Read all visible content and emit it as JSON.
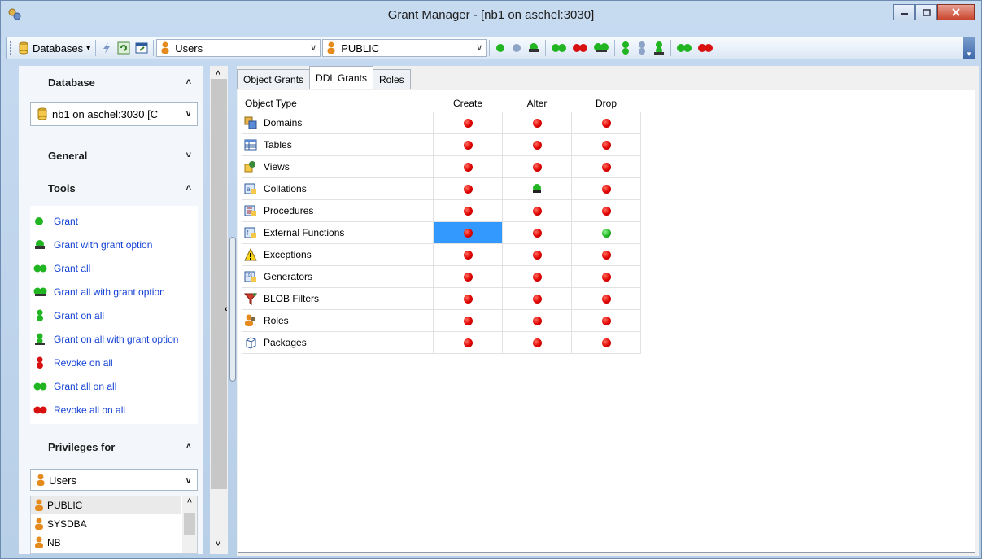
{
  "window": {
    "title": "Grant Manager - [nb1 on aschel:3030]"
  },
  "toolbar": {
    "databases_label": "Databases",
    "dropdown_arrow": "▾",
    "object_kind_value": "Users",
    "grantee_value": "PUBLIC"
  },
  "sidebar": {
    "database_header": "Database",
    "database_value": "nb1 on aschel:3030 [C",
    "general_header": "General",
    "tools_header": "Tools",
    "tools": [
      {
        "label": "Grant",
        "icon": "grant-icon"
      },
      {
        "label": "Grant with grant option",
        "icon": "grant-with-option-icon"
      },
      {
        "label": "Grant all",
        "icon": "grant-all-icon"
      },
      {
        "label": "Grant all with grant option",
        "icon": "grant-all-with-option-icon"
      },
      {
        "label": "Grant on all",
        "icon": "grant-on-all-icon"
      },
      {
        "label": "Grant on all with grant option",
        "icon": "grant-on-all-with-option-icon"
      },
      {
        "label": "Revoke on all",
        "icon": "revoke-on-all-icon"
      },
      {
        "label": "Grant all on all",
        "icon": "grant-all-on-all-icon"
      },
      {
        "label": "Revoke all on all",
        "icon": "revoke-all-on-all-icon"
      }
    ],
    "privileges_header": "Privileges for",
    "privileges_value": "Users",
    "users": [
      "PUBLIC",
      "SYSDBA",
      "NB"
    ],
    "chevron_up": "˄",
    "chevron_down": "˅"
  },
  "tabs": [
    "Object Grants",
    "DDL Grants",
    "Roles"
  ],
  "grid": {
    "headers": [
      "Object Type",
      "Create",
      "Alter",
      "Drop"
    ],
    "rows": [
      {
        "name": "Domains",
        "icon": "domain-icon",
        "create": "red",
        "alter": "red",
        "drop": "red"
      },
      {
        "name": "Tables",
        "icon": "table-icon",
        "create": "red",
        "alter": "red",
        "drop": "red"
      },
      {
        "name": "Views",
        "icon": "view-icon",
        "create": "red",
        "alter": "red",
        "drop": "red"
      },
      {
        "name": "Collations",
        "icon": "collation-icon",
        "create": "red",
        "alter": "grant-option",
        "drop": "red"
      },
      {
        "name": "Procedures",
        "icon": "procedure-icon",
        "create": "red",
        "alter": "red",
        "drop": "red"
      },
      {
        "name": "External Functions",
        "icon": "udf-icon",
        "create": "red",
        "alter": "red",
        "drop": "green"
      },
      {
        "name": "Exceptions",
        "icon": "warning-icon",
        "create": "red",
        "alter": "red",
        "drop": "red"
      },
      {
        "name": "Generators",
        "icon": "generator-icon",
        "create": "red",
        "alter": "red",
        "drop": "red"
      },
      {
        "name": "BLOB Filters",
        "icon": "filter-icon",
        "create": "red",
        "alter": "red",
        "drop": "red"
      },
      {
        "name": "Roles",
        "icon": "roles-icon",
        "create": "red",
        "alter": "red",
        "drop": "red"
      },
      {
        "name": "Packages",
        "icon": "package-icon",
        "create": "red",
        "alter": "red",
        "drop": "red"
      }
    ],
    "selected_cell": {
      "row": "External Functions",
      "column": "Create"
    }
  },
  "colors": {
    "link": "#1240d4",
    "granted": "#22b522",
    "revoked": "#e00000",
    "selection": "#3399ff"
  }
}
